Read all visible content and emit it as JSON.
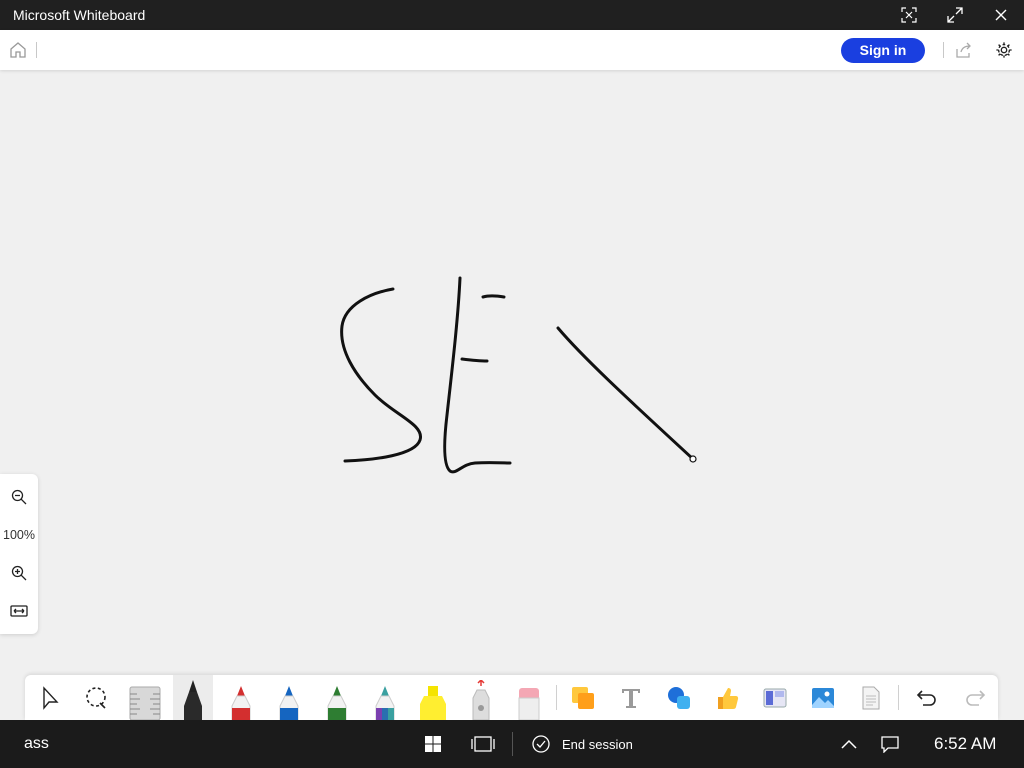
{
  "window": {
    "title": "Microsoft Whiteboard"
  },
  "header": {
    "sign_in_label": "Sign in"
  },
  "zoom": {
    "level": "100%"
  },
  "taskbar": {
    "user": "ass",
    "end_session_label": "End session",
    "time": "6:52 AM"
  },
  "colors": {
    "accent": "#1a3fe0",
    "titlebar": "#202020",
    "taskbar": "#1b1b1b",
    "canvas": "#f0f0f0",
    "ink": "#111111"
  }
}
